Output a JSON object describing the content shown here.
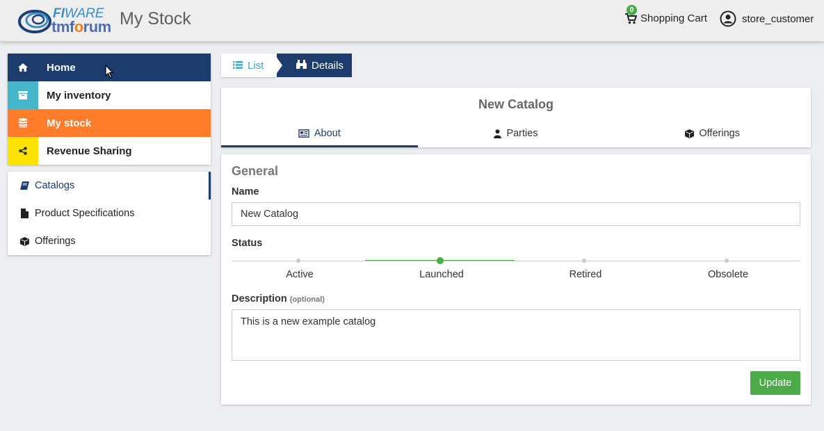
{
  "header": {
    "logo_fi": "FI",
    "logo_ware": "WARE",
    "logo_tm": "tmf",
    "logo_o": "o",
    "logo_rum": "rum",
    "app_title": "My Stock",
    "cart_count": "0",
    "cart_label": "Shopping Cart",
    "user_label": "store_customer"
  },
  "main_menu": {
    "items": [
      {
        "label": "Home",
        "icon": "home-icon"
      },
      {
        "label": "My inventory",
        "icon": "archive-icon"
      },
      {
        "label": "My stock",
        "icon": "database-icon"
      },
      {
        "label": "Revenue Sharing",
        "icon": "share-icon"
      }
    ]
  },
  "sub_menu": {
    "items": [
      {
        "label": "Catalogs",
        "icon": "book-icon"
      },
      {
        "label": "Product Specifications",
        "icon": "file-icon"
      },
      {
        "label": "Offerings",
        "icon": "cube-icon"
      }
    ]
  },
  "breadcrumb": {
    "list_label": "List",
    "details_label": "Details"
  },
  "card": {
    "title": "New Catalog",
    "tabs": [
      {
        "label": "About",
        "icon": "newspaper-icon"
      },
      {
        "label": "Parties",
        "icon": "user-icon"
      },
      {
        "label": "Offerings",
        "icon": "cube-icon"
      }
    ]
  },
  "form": {
    "section_title": "General",
    "name_label": "Name",
    "name_value": "New Catalog",
    "status_label": "Status",
    "status_options": [
      "Active",
      "Launched",
      "Retired",
      "Obsolete"
    ],
    "status_selected": "Launched",
    "description_label": "Description",
    "description_optional": "(optional)",
    "description_value": "This is a new example catalog",
    "update_label": "Update"
  },
  "colors": {
    "navy": "#1c3c6e",
    "teal": "#46b7cb",
    "orange": "#ff7c2a",
    "yellow": "#ffe300",
    "green": "#4caa49"
  }
}
